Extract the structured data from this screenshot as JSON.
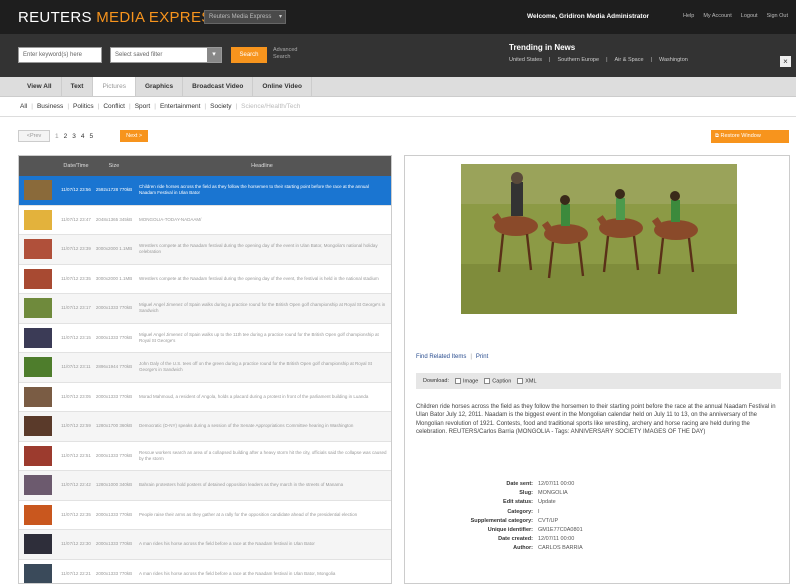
{
  "header": {
    "logo_main": "REUTERS",
    "logo_accent": "MEDIA EXPRESS",
    "product_select": "Reuters Media Express",
    "welcome": "Welcome, Gridiron Media Administrator",
    "links": [
      "Help",
      "My Account",
      "Logout",
      "Sign Out"
    ]
  },
  "search": {
    "keyword_placeholder": "Enter keyword(s) here",
    "select_placeholder": "Select saved filter",
    "button": "Search",
    "advanced": [
      "Advanced",
      "Search"
    ]
  },
  "trending": {
    "title": "Trending in News",
    "items": [
      "United States",
      "Southern Europe",
      "Air & Space",
      "Washington"
    ]
  },
  "tabs": [
    {
      "label": "View All",
      "active": false
    },
    {
      "label": "Text",
      "active": false
    },
    {
      "label": "Pictures",
      "active": true
    },
    {
      "label": "Graphics",
      "active": false
    },
    {
      "label": "Broadcast Video",
      "active": false
    },
    {
      "label": "Online Video",
      "active": false
    }
  ],
  "categories": [
    "All",
    "Business",
    "Politics",
    "Conflict",
    "Sport",
    "Entertainment",
    "Society",
    "Science/Health/Tech"
  ],
  "pagination": {
    "prev": "<Prev",
    "pages": [
      "1",
      "2",
      "3",
      "4",
      "5"
    ],
    "current_index": 0,
    "next": "Next >",
    "restore": "Restore Window"
  },
  "table": {
    "columns": [
      "Date/Time",
      "Size",
      "Headline"
    ],
    "rows": [
      {
        "date": "11/07/12 23:56",
        "size": "2592x1728 770kB",
        "headline": "Children ride horses across the field as they follow the horsemen to their starting point before the race at the annual Naadam Festival in Ulan Bator",
        "thumb": "#8a6a3a",
        "selected": true
      },
      {
        "date": "11/07/12 23:47",
        "size": "2048x1365 345kB",
        "headline": "MONGOLIA-TODAY-NADAAM/",
        "thumb": "#e3b23c",
        "selected": false
      },
      {
        "date": "11/07/12 23:39",
        "size": "3000x2000 1.1MB",
        "headline": "Wrestlers compete at the Naadam festival during the opening day of the event in Ulan Bator, Mongolia's national holiday celebration",
        "thumb": "#b0503a",
        "selected": false
      },
      {
        "date": "11/07/12 23:35",
        "size": "3000x2000 1.1MB",
        "headline": "Wrestlers compete at the Naadam festival during the opening day of the event, the festival is held in the national stadium",
        "thumb": "#a84a32",
        "selected": false
      },
      {
        "date": "11/07/12 23:17",
        "size": "2000x1333 770kB",
        "headline": "Miguel Angel Jimenez of Spain walks during a practice round for the British Open golf championship at Royal St George's in Sandwich",
        "thumb": "#6f8a3c",
        "selected": false
      },
      {
        "date": "11/07/12 23:15",
        "size": "2000x1333 770kB",
        "headline": "Miguel Angel Jimenez of Spain walks up to the 11th tee during a practice round for the British Open golf championship at Royal St George's",
        "thumb": "#3b3b56",
        "selected": false
      },
      {
        "date": "11/07/12 23:11",
        "size": "2896x1944 770kB",
        "headline": "John Daly of the U.S. tees off on the green during a practice round for the British Open golf championship at Royal St George's in Sandwich",
        "thumb": "#4e7d2c",
        "selected": false
      },
      {
        "date": "11/07/12 23:05",
        "size": "2000x1333 770kB",
        "headline": "Morad Mahmoud, a resident of Angola, holds a placard during a protest in front of the parliament building in Luanda",
        "thumb": "#7a5c44",
        "selected": false
      },
      {
        "date": "11/07/12 22:59",
        "size": "1280x1700 360kB",
        "headline": "Democratic (D-NY) speaks during a session of the Senate Appropriations Committee hearing in Washington",
        "thumb": "#5a3a2a",
        "selected": false
      },
      {
        "date": "11/07/12 22:51",
        "size": "2000x1333 770kB",
        "headline": "Rescue workers search an area of a collapsed building after a heavy storm hit the city, officials said the collapse was caused by the storm",
        "thumb": "#9c3b2e",
        "selected": false
      },
      {
        "date": "11/07/12 22:42",
        "size": "1280x1000 340kB",
        "headline": "Bahrain protesters hold posters of detained opposition leaders as they march in the streets of Manama",
        "thumb": "#6c5a6e",
        "selected": false
      },
      {
        "date": "11/07/12 22:35",
        "size": "2000x1333 770kB",
        "headline": "People raise their arms as they gather at a rally for the opposition candidate ahead of the presidential election",
        "thumb": "#c9571e",
        "selected": false
      },
      {
        "date": "11/07/12 22:30",
        "size": "2000x1333 770kB",
        "headline": "A man rides his horse across the field before a race at the Naadam festival in Ulan Bator",
        "thumb": "#2e2e3a",
        "selected": false
      },
      {
        "date": "11/07/12 22:21",
        "size": "2000x1333 770kB",
        "headline": "A man rides his horse across the field before a race at the Naadam festival in Ulan Bator, Mongolia",
        "thumb": "#3a4a5a",
        "selected": false
      }
    ]
  },
  "detail": {
    "links": [
      "Find Related Items",
      "Print"
    ],
    "download_label": "Download:",
    "download_options": [
      "Image",
      "Caption",
      "XML"
    ],
    "caption": "Children ride horses across the field as they follow the horsemen to their starting point before the race at the annual Naadam Festival in Ulan Bator July 12, 2011. Naadam is the biggest event in the Mongolian calendar held on July 11 to 13, on the anniversary of the Mongolian revolution of 1921. Contests, food and traditional sports like wrestling, archery and horse racing are held during the celebration. REUTERS/Carlos Barria (MONGOLIA - Tags: ANNIVERSARY SOCIETY IMAGES OF THE DAY)",
    "meta": [
      {
        "k": "Date sent:",
        "v": "12/07/11 00:00"
      },
      {
        "k": "Slug:",
        "v": "MONGOLIA"
      },
      {
        "k": "Edit status:",
        "v": "Update"
      },
      {
        "k": "Category:",
        "v": "I"
      },
      {
        "k": "Supplemental category:",
        "v": "CVT/UP"
      },
      {
        "k": "Unique identifier:",
        "v": "GM1E77C0A0801"
      },
      {
        "k": "Date created:",
        "v": "12/07/11 00:00"
      },
      {
        "k": "Author:",
        "v": "CARLOS BARRIA"
      }
    ]
  }
}
